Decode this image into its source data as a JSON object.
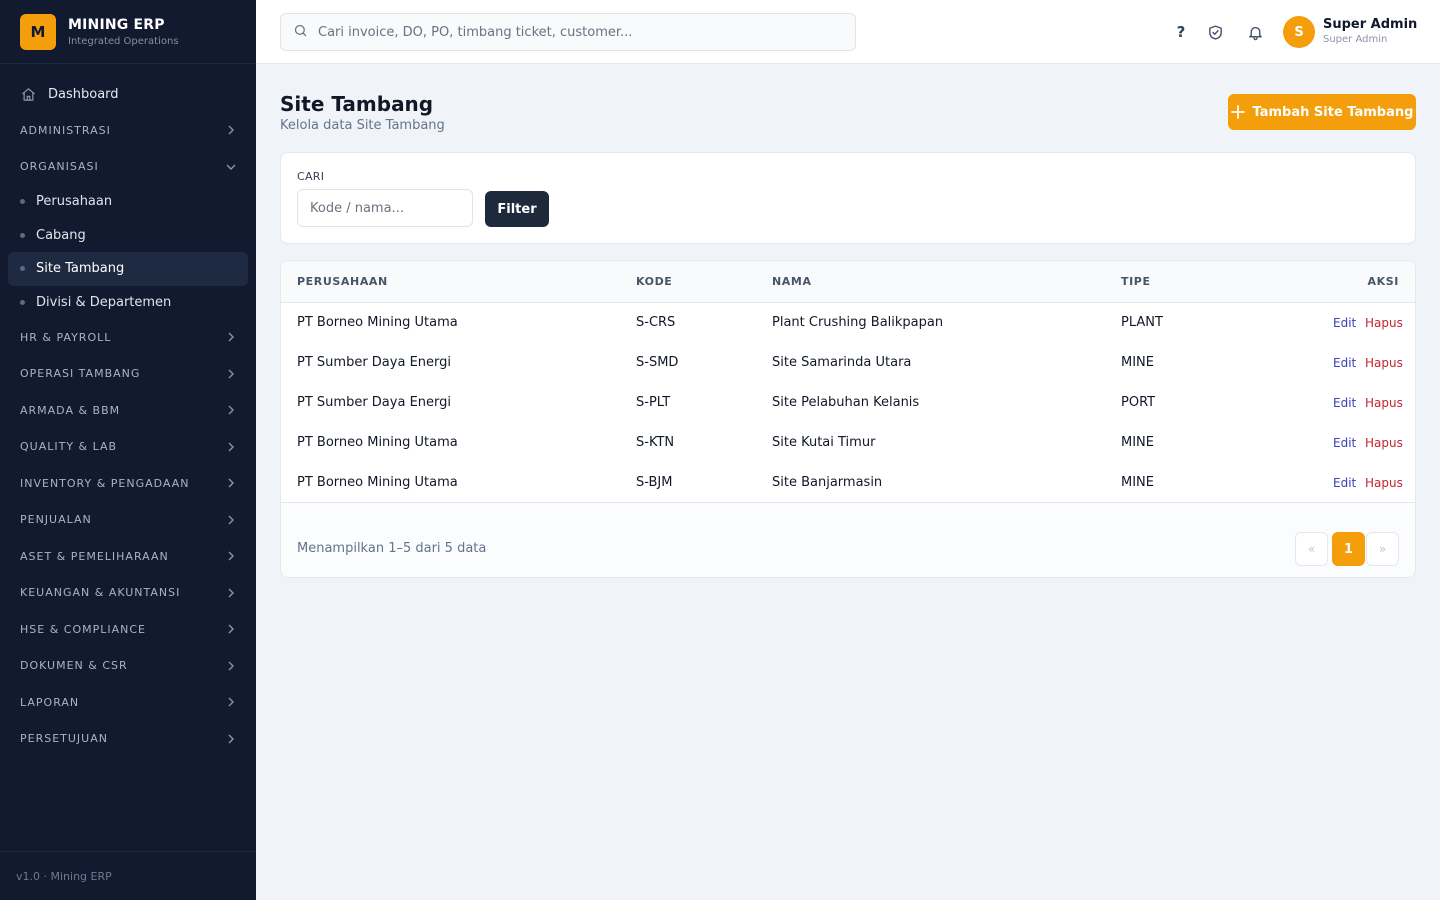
{
  "brand": {
    "logo_letter": "M",
    "title": "MINING ERP",
    "subtitle": "Integrated Operations"
  },
  "sidebar": {
    "dashboard": "Dashboard",
    "sections": {
      "administrasi": "ADMINISTRASI",
      "organisasi": "ORGANISASI",
      "hr": "HR & PAYROLL",
      "operasi": "OPERASI TAMBANG",
      "armada": "ARMADA & BBM",
      "quality": "QUALITY & LAB",
      "inventory": "INVENTORY & PENGADAAN",
      "penjualan": "PENJUALAN",
      "aset": "ASET & PEMELIHARAAN",
      "keuangan": "KEUANGAN & AKUNTANSI",
      "hse": "HSE & COMPLIANCE",
      "dokumen": "DOKUMEN & CSR",
      "laporan": "LAPORAN",
      "persetujuan": "PERSETUJUAN"
    },
    "organisasi_items": [
      "Perusahaan",
      "Cabang",
      "Site Tambang",
      "Divisi & Departemen"
    ],
    "footer": "v1.0 · Mining ERP"
  },
  "topbar": {
    "search_placeholder": "Cari invoice, DO, PO, timbang ticket, customer...",
    "help": "?",
    "avatar_letter": "S",
    "user_name": "Super Admin",
    "user_role": "Super Admin"
  },
  "page": {
    "title": "Site Tambang",
    "subtitle": "Kelola data Site Tambang",
    "add_button": "Tambah Site Tambang"
  },
  "filter": {
    "label": "CARI",
    "placeholder": "Kode / nama...",
    "button": "Filter"
  },
  "table": {
    "headers": {
      "perusahaan": "PERUSAHAAN",
      "kode": "KODE",
      "nama": "NAMA",
      "tipe": "TIPE",
      "aksi": "AKSI"
    },
    "rows": [
      {
        "perusahaan": "PT Borneo Mining Utama",
        "kode": "S-CRS",
        "nama": "Plant Crushing Balikpapan",
        "tipe": "PLANT"
      },
      {
        "perusahaan": "PT Sumber Daya Energi",
        "kode": "S-SMD",
        "nama": "Site Samarinda Utara",
        "tipe": "MINE"
      },
      {
        "perusahaan": "PT Sumber Daya Energi",
        "kode": "S-PLT",
        "nama": "Site Pelabuhan Kelanis",
        "tipe": "PORT"
      },
      {
        "perusahaan": "PT Borneo Mining Utama",
        "kode": "S-KTN",
        "nama": "Site Kutai Timur",
        "tipe": "MINE"
      },
      {
        "perusahaan": "PT Borneo Mining Utama",
        "kode": "S-BJM",
        "nama": "Site Banjarmasin",
        "tipe": "MINE"
      }
    ],
    "edit_label": "Edit",
    "delete_label": "Hapus",
    "footer_text": "Menampilkan 1–5 dari 5 data",
    "pagination": {
      "prev": "«",
      "current": "1",
      "next": "»"
    }
  },
  "colors": {
    "accent": "#f59e0b",
    "sidebar_bg": "#111a2e",
    "edit": "#3b3fb8",
    "delete": "#c0262d"
  }
}
